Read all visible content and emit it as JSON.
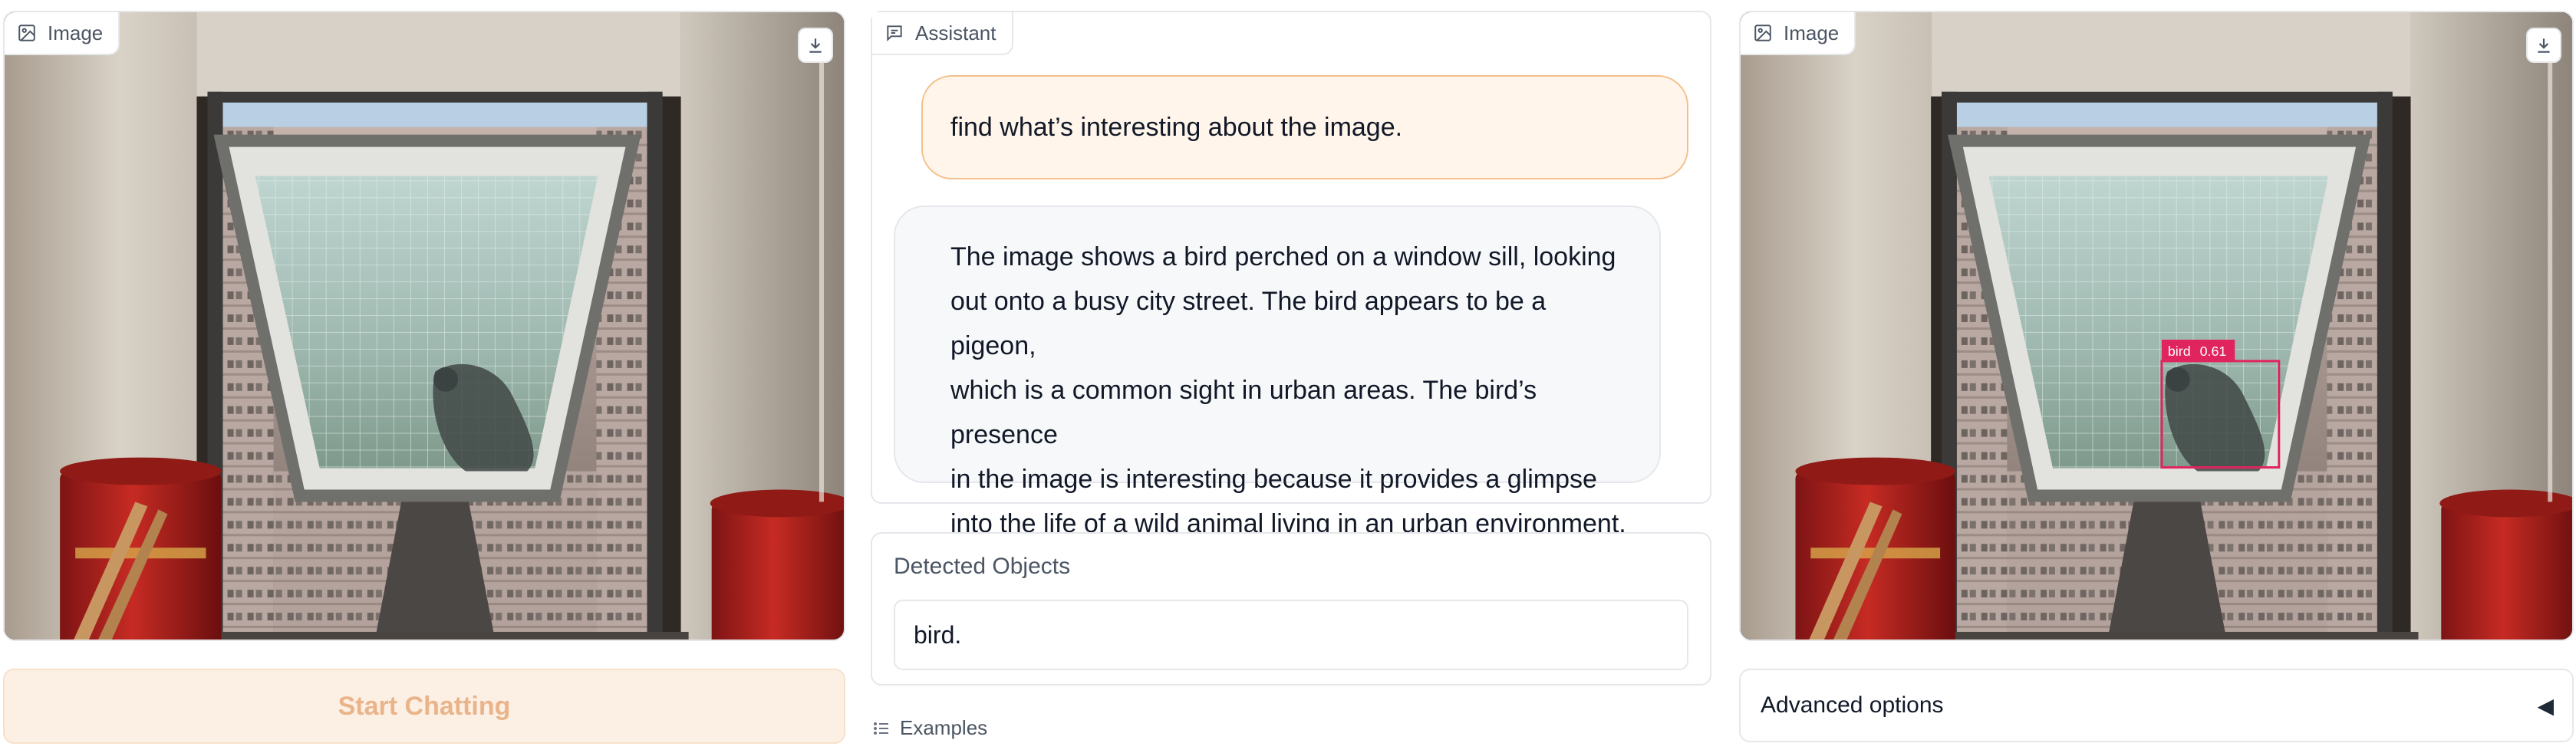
{
  "left_image": {
    "label": "Image"
  },
  "start_button": {
    "label": "Start Chatting"
  },
  "chat": {
    "label": "Assistant",
    "messages": [
      {
        "role": "user",
        "text": "find what’s interesting about the image."
      },
      {
        "role": "assistant",
        "lines": [
          "The image shows a bird perched on a window sill, looking",
          "out onto a busy city street. The bird appears to be a pigeon,",
          "which is a common sight in urban areas. The bird’s presence",
          "in the image is interesting because it provides a glimpse",
          "into the life of a wild animal living in an urban environment."
        ]
      }
    ]
  },
  "detected_objects": {
    "label": "Detected Objects",
    "value": "bird."
  },
  "examples": {
    "label": "Examples"
  },
  "right_image": {
    "label": "Image",
    "detection": {
      "label": "bird",
      "score": "0.61",
      "color": "#e0245e"
    }
  },
  "advanced_options": {
    "label": "Advanced options",
    "caret": "◀"
  },
  "icons": {
    "image": "image-icon",
    "download": "download-icon",
    "chat": "chat-icon",
    "list": "list-icon"
  }
}
